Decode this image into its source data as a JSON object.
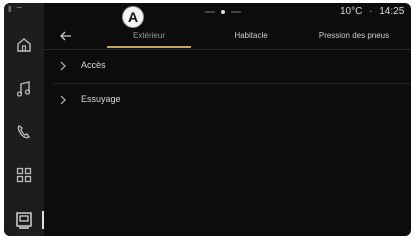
{
  "status": {
    "left_icons": "0 ☷",
    "temperature": "10°C",
    "separator": "·",
    "time": "14:25"
  },
  "callout": {
    "label": "A"
  },
  "tabs": [
    {
      "label": "Extérieur",
      "active": true
    },
    {
      "label": "Habitacle",
      "active": false
    },
    {
      "label": "Pression des pneus",
      "active": false
    }
  ],
  "rows": [
    {
      "label": "Accès"
    },
    {
      "label": "Essuyage"
    }
  ],
  "sidebar": {
    "items": [
      {
        "icon": "home-icon"
      },
      {
        "icon": "music-icon"
      },
      {
        "icon": "phone-icon"
      },
      {
        "icon": "apps-grid-icon"
      },
      {
        "icon": "vehicle-settings-icon",
        "active": true
      }
    ]
  },
  "colors": {
    "background": "#0c0c0c",
    "sidebar": "#1d1d1d",
    "accent": "#c9a35a",
    "text": "#d8d8d8"
  }
}
